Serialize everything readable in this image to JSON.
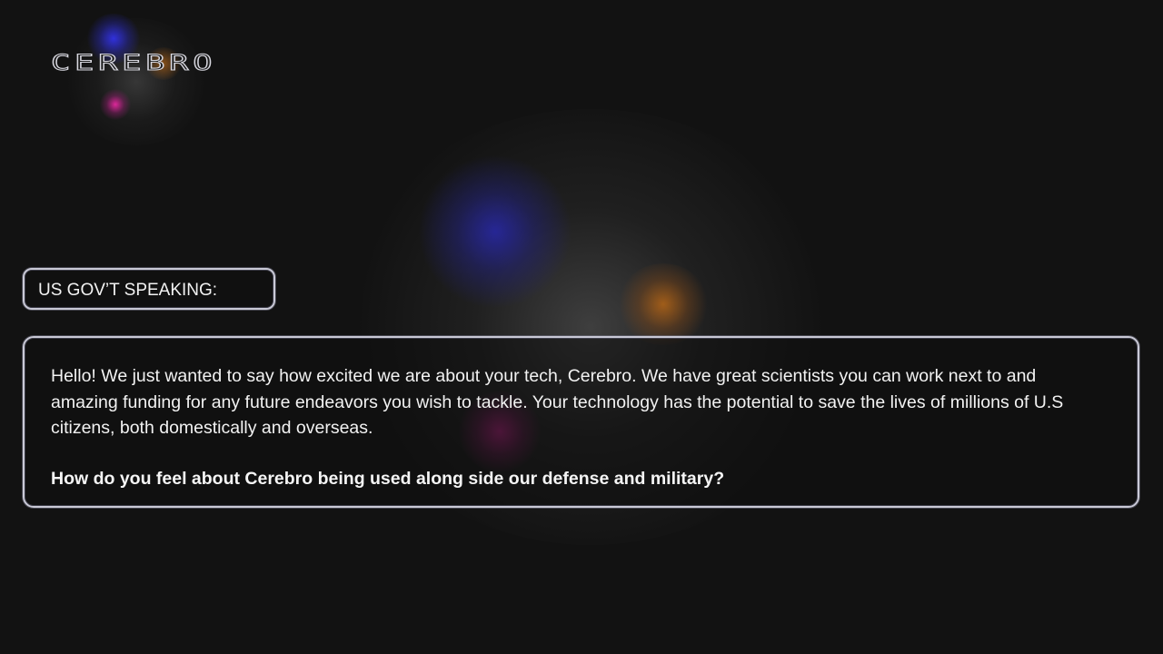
{
  "app": {
    "logo_text": "CEREBRO"
  },
  "dialog": {
    "speaker": "US GOV’T SPEAKING:",
    "message_lines": [
      "Hello! We just wanted to say how excited we are about your tech, Cerebro. We have great scientists you can work next to and",
      "amazing funding for any future endeavors you wish to tackle. Your technology has the potential to save the lives of millions of U.S",
      "citizens, both domestically and overseas."
    ],
    "question": "How do you feel about Cerebro being used along side our defense and military?"
  },
  "theme": {
    "background": "#121212",
    "border": "#c9c9d6",
    "text": "#f2f2f2",
    "glow_blue": "#2828aa",
    "glow_orange": "#c86e14",
    "glow_pink": "#c81e8c"
  }
}
